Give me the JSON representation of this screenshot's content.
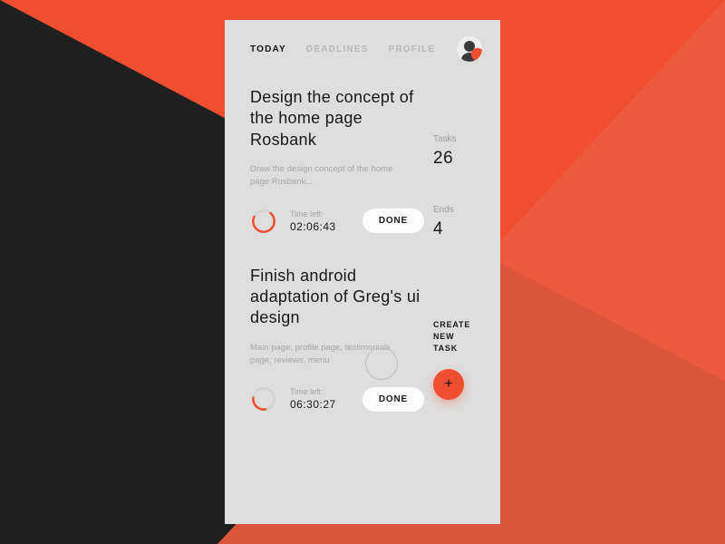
{
  "nav": {
    "tabs": [
      "TODAY",
      "DEADLINES",
      "PROFILE"
    ],
    "active_index": 0
  },
  "tasks": [
    {
      "title": "Design the concept of the home page Rosbank",
      "description": "Draw the design concept of the home page Rosbank...",
      "time_label": "Time left:",
      "time_value": "02:06:43",
      "button": "DONE",
      "progress": 0.7
    },
    {
      "title": "Finish android adaptation of Greg's ui design",
      "description": "Main page, profile page, testimonials page, reviews, menu",
      "time_label": "Time left:",
      "time_value": "06:30:27",
      "button": "DONE",
      "progress": 0.3
    }
  ],
  "sidebar": {
    "stats": [
      {
        "label": "Tasks",
        "value": "26"
      },
      {
        "label": "Ends",
        "value": "4"
      }
    ],
    "cta_line1": "CREATE",
    "cta_line2": "NEW",
    "cta_line3": "TASK",
    "fab_glyph": "+"
  },
  "colors": {
    "accent": "#f04e31",
    "dark": "#1f1f1f",
    "card": "#dedede"
  }
}
